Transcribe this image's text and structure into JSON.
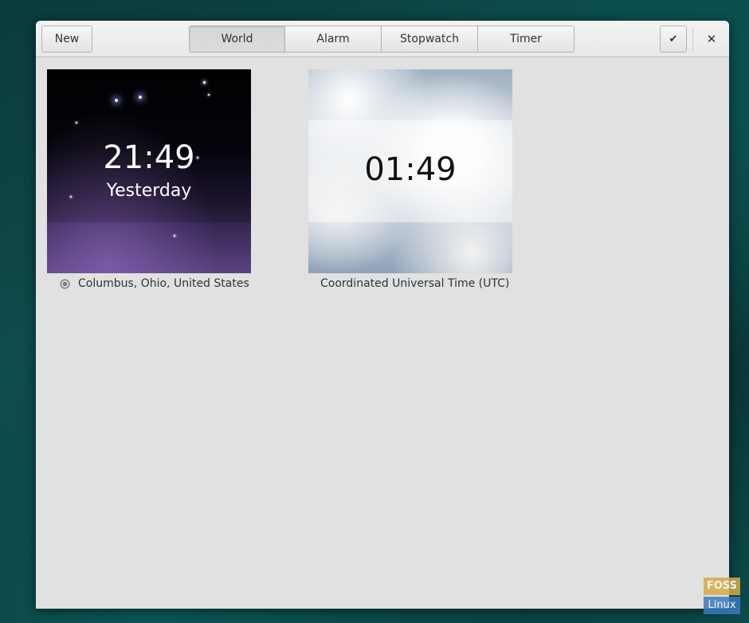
{
  "header": {
    "new_label": "New",
    "tabs": [
      {
        "label": "World",
        "active": true
      },
      {
        "label": "Alarm",
        "active": false
      },
      {
        "label": "Stopwatch",
        "active": false
      },
      {
        "label": "Timer",
        "active": false
      }
    ],
    "select_icon": "check-icon",
    "select_glyph": "✔",
    "close_icon": "close-icon",
    "close_glyph": "✕"
  },
  "clocks": [
    {
      "time": "21:49",
      "day": "Yesterday",
      "location": "Columbus, Ohio, United States",
      "current_location": true,
      "theme": "night"
    },
    {
      "time": "01:49",
      "day": "",
      "location": "Coordinated Universal Time (UTC)",
      "current_location": false,
      "theme": "day"
    }
  ],
  "watermark": {
    "line1": "FOSS",
    "line2": "Linux"
  },
  "colors": {
    "window_bg": "#e1e1e1",
    "desktop": "#0f4a4b",
    "text": "#2e3436"
  }
}
